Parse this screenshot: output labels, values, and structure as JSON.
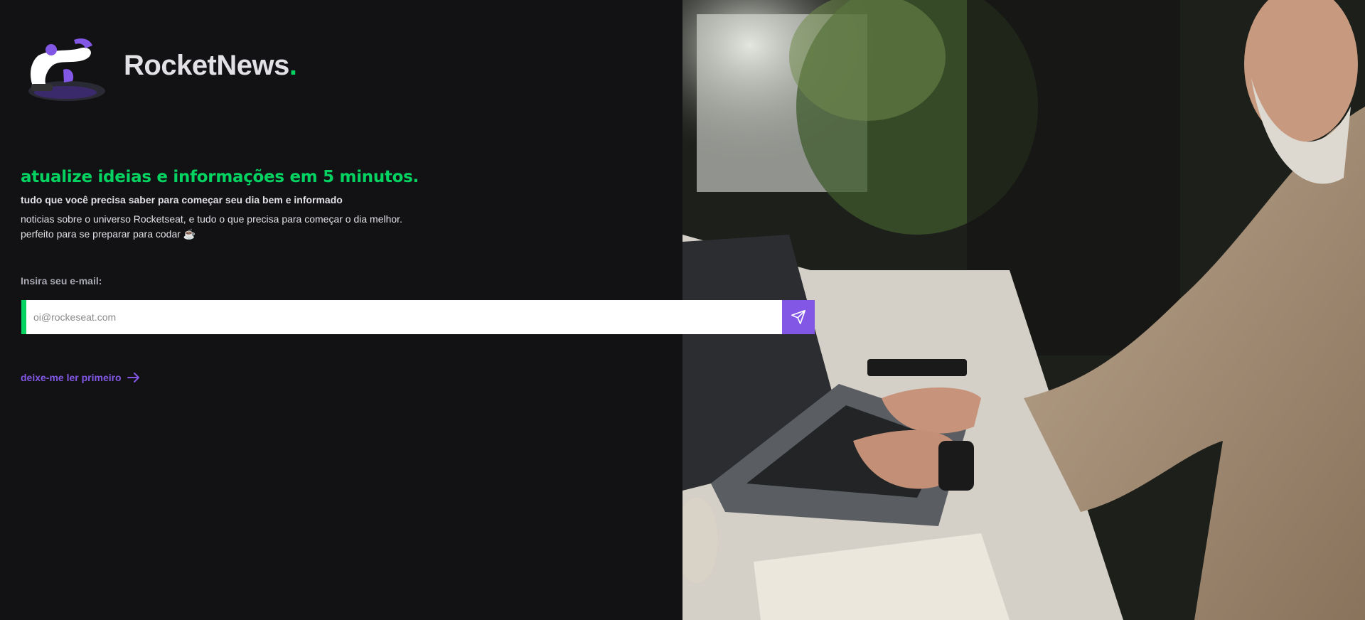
{
  "brand": {
    "name": "RocketNews",
    "dot": "."
  },
  "hero": {
    "headline": "atualize ideias e informações em 5 minutos.",
    "subtitle": "tudo que você precisa saber para começar seu dia bem e informado",
    "body_line1": "noticias sobre o universo Rocketseat, e tudo o que precisa para começar o dia melhor.",
    "body_line2": "perfeito para se preparar para codar ☕"
  },
  "form": {
    "label": "Insira seu e-mail:",
    "email_placeholder": "oi@rockeseat.com",
    "email_value": "",
    "submit_icon": "send-icon"
  },
  "read_first_link": {
    "label": "deixe-me ler primeiro",
    "icon": "arrow-right-icon"
  },
  "colors": {
    "background": "#121214",
    "accent_green": "#04d361",
    "accent_purple": "#8257e5",
    "text": "#e1e1e6"
  }
}
